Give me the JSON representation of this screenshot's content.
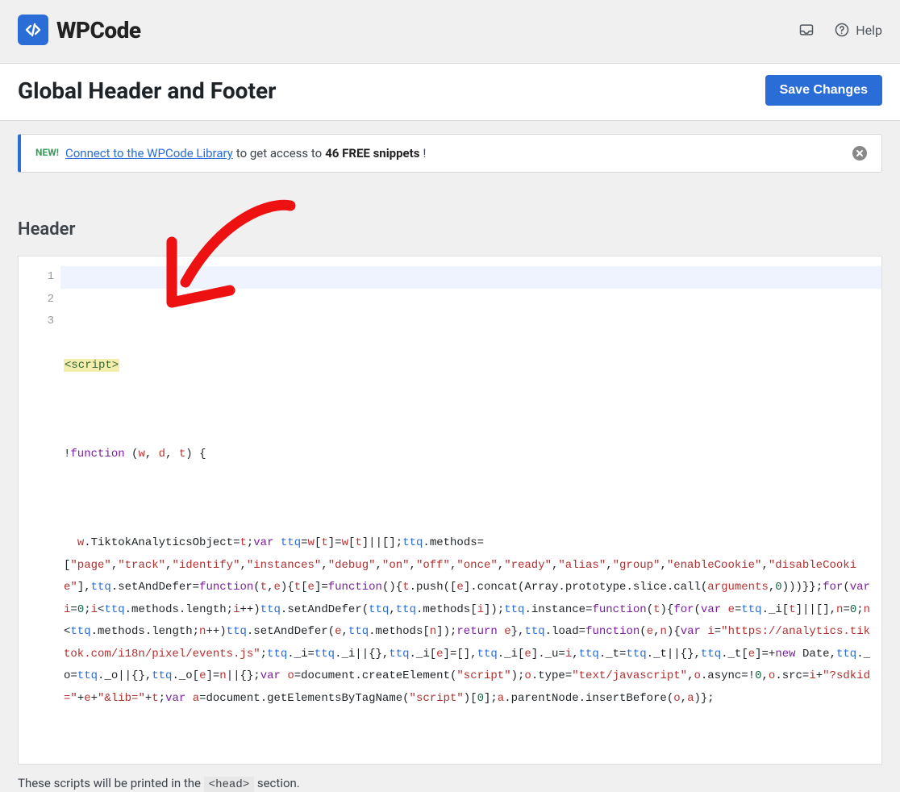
{
  "brand": {
    "name": "WPCode"
  },
  "top": {
    "help_label": "Help"
  },
  "page": {
    "title": "Global Header and Footer",
    "save_label": "Save Changes"
  },
  "notice": {
    "badge": "NEW!",
    "link_text": "Connect to the WPCode Library",
    "mid_text": " to get access to ",
    "bold_text": "46 FREE snippets",
    "end_text": "!"
  },
  "sections": {
    "header_label": "Header"
  },
  "editor": {
    "line_numbers": [
      "1",
      "2",
      "3"
    ],
    "line1": "<script>",
    "line2_parts": {
      "bang": "!",
      "function": "function",
      "space": " (",
      "w": "w",
      "c1": ", ",
      "d": "d",
      "c2": ", ",
      "t": "t",
      "end": ") {"
    }
  },
  "code": {
    "tiktok_obj": "TiktokAnalyticsObject",
    "methods": [
      "\"page\"",
      "\"track\"",
      "\"identify\"",
      "\"instances\"",
      "\"debug\"",
      "\"on\"",
      "\"off\"",
      "\"once\"",
      "\"ready\"",
      "\"alias\"",
      "\"group\"",
      "\"enableCookie\"",
      "\"disableCookie\""
    ],
    "url": "\"https://analytics.tiktok.com/i18n/pixel/events.js\"",
    "script_str": "\"script\"",
    "textjs_str": "\"text/javascript\"",
    "sdkid_str": "\"?sdkid=\"",
    "lib_str": "\"&lib=\""
  },
  "footnote": {
    "prefix": "These scripts will be printed in the ",
    "code": "<head>",
    "suffix": " section."
  }
}
